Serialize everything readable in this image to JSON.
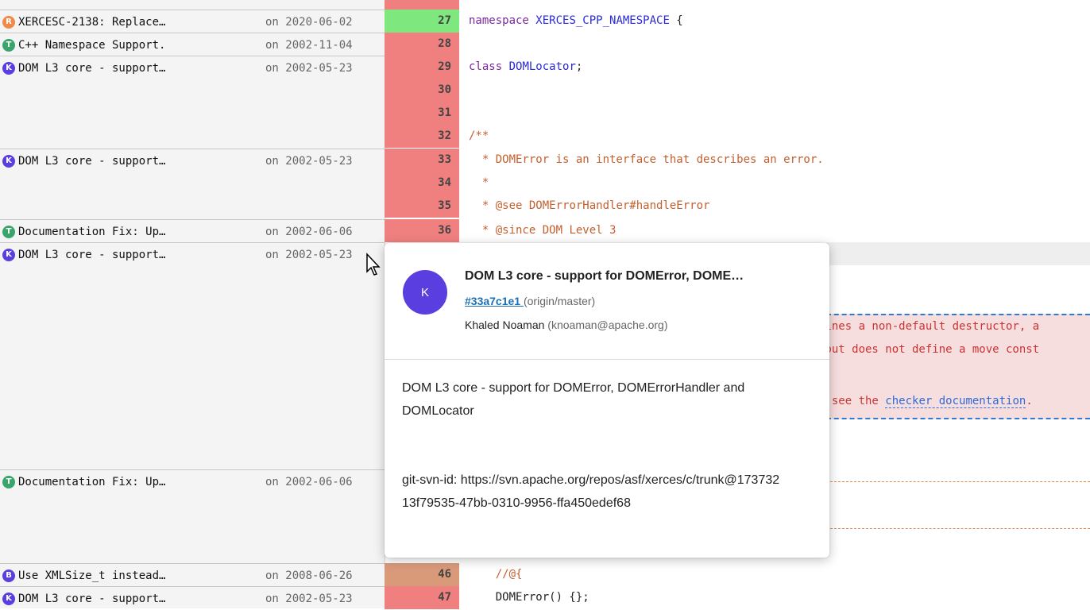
{
  "blame": [
    {
      "avatar_letter": "R",
      "avatar_color": "#f08a4b",
      "message": "XERCESC-2138: Replace…",
      "date": "on 2020-06-02"
    },
    {
      "avatar_letter": "T",
      "avatar_color": "#3aa56b",
      "message": "C++ Namespace Support.",
      "date": "on 2002-11-04"
    },
    {
      "avatar_letter": "K",
      "avatar_color": "#5a3ee0",
      "message": "DOM L3 core - support…",
      "date": "on 2002-05-23"
    },
    {
      "avatar_letter": "K",
      "avatar_color": "#5a3ee0",
      "message": "DOM L3 core - support…",
      "date": "on 2002-05-23"
    },
    {
      "avatar_letter": "T",
      "avatar_color": "#3aa56b",
      "message": "Documentation Fix: Up…",
      "date": "on 2002-06-06"
    },
    {
      "avatar_letter": "K",
      "avatar_color": "#5a3ee0",
      "message": "DOM L3 core - support…",
      "date": "on 2002-05-23"
    },
    {
      "avatar_letter": "T",
      "avatar_color": "#3aa56b",
      "message": "Documentation Fix: Up…",
      "date": "on 2002-06-06"
    },
    {
      "avatar_letter": "B",
      "avatar_color": "#5a3ee0",
      "message": "Use XMLSize_t instead…",
      "date": "on 2008-06-26"
    },
    {
      "avatar_letter": "K",
      "avatar_color": "#5a3ee0",
      "message": "DOM L3 core - support…",
      "date": "on 2002-05-23"
    }
  ],
  "gutter": {
    "lines": [
      "27",
      "28",
      "29",
      "30",
      "31",
      "32",
      "33",
      "34",
      "35",
      "36",
      "46",
      "47"
    ],
    "colors": {
      "recent": "#7ee87e",
      "old": "#f08080",
      "mid": "#d99a7a"
    }
  },
  "code": {
    "l27_kw": "namespace",
    "l27_ty": "XERCES_CPP_NAMESPACE",
    "l27_end": " {",
    "l29_kw": "class",
    "l29_ty": "DOMLocator",
    "l29_end": ";",
    "l32": "/**",
    "l33": "  * DOMError is an interface that describes an error.",
    "l34": "  *",
    "l35_a": "  * ",
    "l35_tag": "@see",
    "l35_b": " DOMErrorHandler#handleError",
    "l36_a": "  * ",
    "l36_tag": "@since",
    "l36_b": " DOM Level 3",
    "l46": "    //@{",
    "l47": "    DOMError() {};"
  },
  "annotation": {
    "line1": "fines a non-default destructor, a",
    "line2": " but does not define a move const",
    "line3_a": "n see the ",
    "line3_link": "checker documentation",
    "line3_b": "."
  },
  "popup": {
    "avatar_letter": "K",
    "title": "DOM L3 core - support for DOMError, DOME…",
    "hash": "#33a7c1e1 ",
    "ref": "(origin/master)",
    "author": "Khaled Noaman",
    "email": "(knoaman@apache.org)",
    "body_1": "DOM L3 core - support for DOMError, DOMErrorHandler and DOMLocator",
    "body_2": "git-svn-id: https://svn.apache.org/repos/asf/xerces/c/trunk@173732 13f79535-47bb-0310-9956-ffa450edef68"
  }
}
